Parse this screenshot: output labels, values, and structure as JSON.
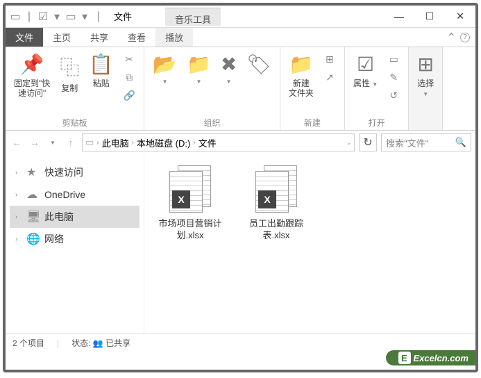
{
  "title": "文件",
  "context_tab": "音乐工具",
  "tabs": {
    "file": "文件",
    "home": "主页",
    "share": "共享",
    "view": "查看",
    "play": "播放"
  },
  "ribbon": {
    "pin": "固定到\"快\n速访问\"",
    "copy": "复制",
    "paste": "粘贴",
    "clipboard_label": "剪贴板",
    "organize_label": "组织",
    "newfolder": "新建\n文件夹",
    "new_label": "新建",
    "properties": "属性",
    "open_label": "打开",
    "select": "选择"
  },
  "breadcrumb": {
    "pc": "此电脑",
    "drive": "本地磁盘 (D:)",
    "folder": "文件"
  },
  "search_placeholder": "搜索\"文件\"",
  "nav": {
    "quick": "快速访问",
    "onedrive": "OneDrive",
    "pc": "此电脑",
    "network": "网络"
  },
  "files": [
    {
      "name": "市场项目营销计划.xlsx"
    },
    {
      "name": "员工出勤跟踪表.xlsx"
    }
  ],
  "status": {
    "count": "2 个项目",
    "state_label": "状态:",
    "state_value": "已共享"
  },
  "watermark": "Excelcn.com"
}
